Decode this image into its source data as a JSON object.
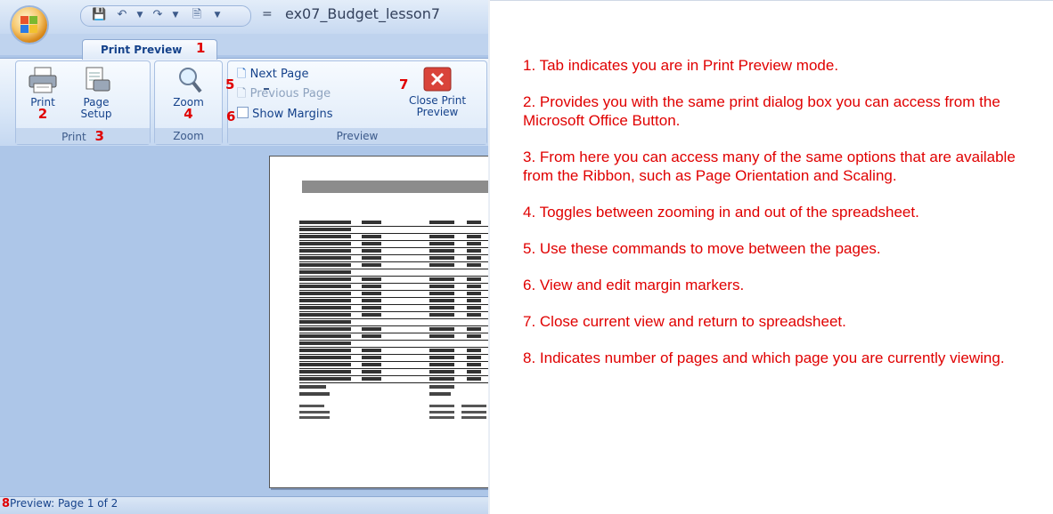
{
  "title_bar": {
    "document_title": "ex07_Budget_lesson7",
    "separator": "="
  },
  "tab": {
    "label": "Print Preview",
    "marker": "1"
  },
  "groups": {
    "print": {
      "label": "Print",
      "marker": "3",
      "print_button": {
        "label": "Print",
        "marker": "2"
      },
      "page_setup_button": {
        "line1": "Page",
        "line2": "Setup"
      }
    },
    "zoom": {
      "label": "Zoom",
      "button": {
        "label": "Zoom",
        "marker": "4"
      }
    },
    "preview": {
      "label": "Preview",
      "next_page": "Next Page",
      "previous_page": "Previous Page",
      "show_margins": "Show Margins",
      "nav_marker": "5",
      "margins_marker": "6",
      "close": {
        "line1": "Close Print",
        "line2": "Preview",
        "marker": "7"
      }
    }
  },
  "status_bar": {
    "marker": "8",
    "text": "Preview: Page 1 of 2"
  },
  "notes": [
    "1. Tab indicates you are in Print Preview mode.",
    "2. Provides you with the same print dialog box you can access from the Microsoft Office Button.",
    "3. From here you can access many of the same options that are available from the Ribbon, such as Page Orientation and Scaling.",
    "4. Toggles between zooming in and out of the spreadsheet.",
    "5. Use these commands to move between the pages.",
    "6. View and edit margin markers.",
    "7. Close current view and return to spreadsheet.",
    "8. Indicates number of pages and which page you are currently viewing."
  ],
  "colors": {
    "annotation": "#e00000",
    "ribbon_text": "#15428b",
    "app_background": "#adc6e8"
  }
}
